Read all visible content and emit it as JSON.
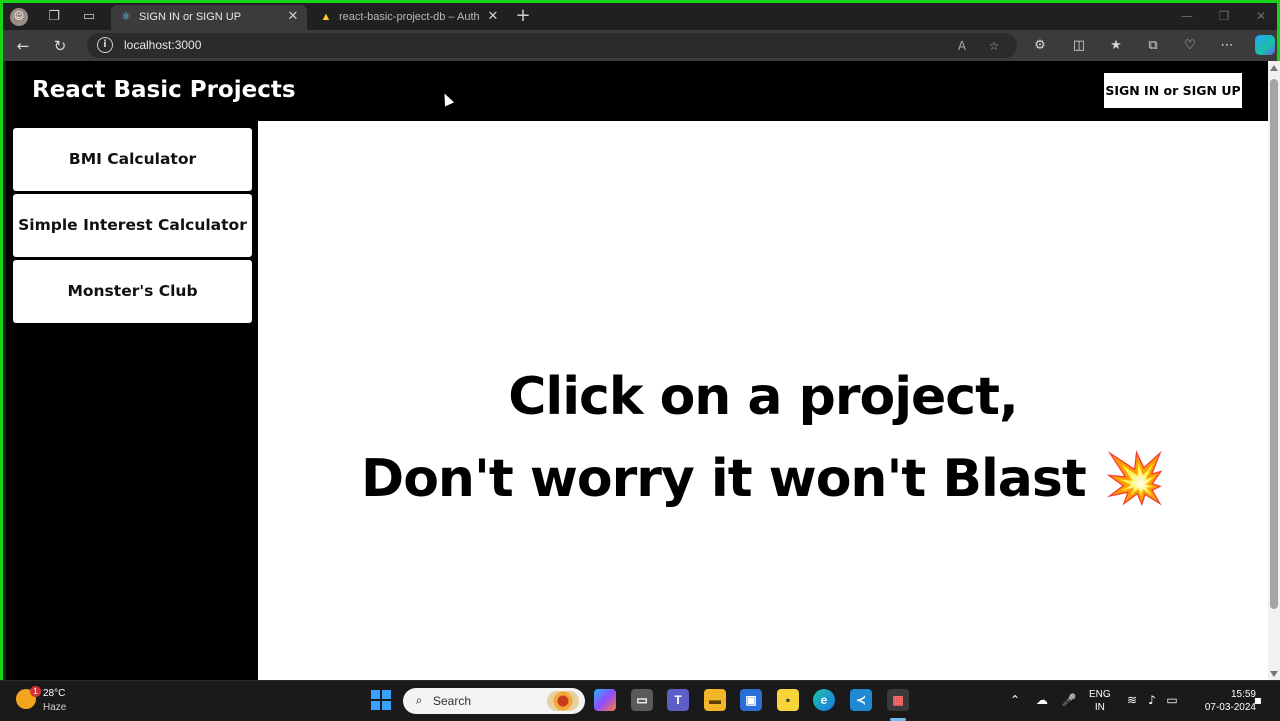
{
  "browser": {
    "tabs": [
      {
        "label": "SIGN IN or SIGN UP",
        "active": true,
        "favicon": "react-icon"
      },
      {
        "label": "react-basic-project-db – Authent",
        "active": false,
        "favicon": "firebase-icon"
      }
    ],
    "url": "localhost:3000"
  },
  "header": {
    "title": "React Basic Projects",
    "signin_label": "SIGN IN or SIGN UP"
  },
  "sidebar": {
    "items": [
      {
        "label": "BMI Calculator"
      },
      {
        "label": "Simple Interest Calculator"
      },
      {
        "label": "Monster's Club"
      }
    ]
  },
  "main": {
    "line1": "Click on a project,",
    "line2": "Don't worry it won't Blast",
    "emoji": "💥"
  },
  "taskbar": {
    "weather": {
      "temp": "28°C",
      "desc": "Haze",
      "badge": "1"
    },
    "search_placeholder": "Search",
    "lang_top": "ENG",
    "lang_bottom": "IN",
    "time": "15:59",
    "date": "07-03-2024"
  },
  "colors": {
    "frame_border": "#17d417",
    "page_bg": "#000000",
    "content_bg": "#ffffff"
  }
}
